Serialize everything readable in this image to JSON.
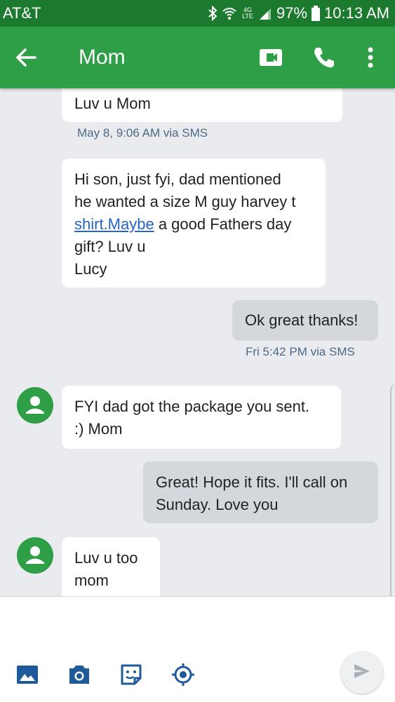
{
  "status_bar": {
    "carrier": "AT&T",
    "network": "4G LTE",
    "battery": "97%",
    "time": "10:13 AM",
    "icons": [
      "bluetooth-icon",
      "wifi-icon",
      "signal-icon",
      "battery-icon"
    ]
  },
  "app_bar": {
    "title": "Mom",
    "icons": [
      "back-arrow-icon",
      "video-call-icon",
      "phone-icon",
      "more-vert-icon"
    ]
  },
  "messages": [
    {
      "direction": "incoming",
      "text": "Luv u Mom",
      "meta": "May 8, 9:06 AM via SMS"
    },
    {
      "direction": "incoming",
      "lines": [
        "Hi son, just fyi, dad mentioned",
        "he wanted a size M guy harvey t"
      ],
      "link": "shirt.Maybe",
      "link_suffix": " a good Fathers day",
      "lines_after": [
        "gift? Luv u",
        "Lucy"
      ]
    },
    {
      "direction": "outgoing",
      "text": "Ok great thanks!",
      "meta": "Fri 5:42 PM via SMS"
    },
    {
      "direction": "incoming",
      "lines": [
        "FYI dad got the package you sent.",
        ":) Mom"
      ]
    },
    {
      "direction": "outgoing",
      "lines": [
        "Great! Hope it fits. I'll call on",
        "Sunday. Love you"
      ]
    },
    {
      "direction": "incoming",
      "lines": [
        "Luv u too",
        "mom"
      ]
    }
  ],
  "compose": {
    "placeholder": "",
    "tools": [
      "gallery-icon",
      "camera-icon",
      "sticker-icon",
      "location-icon"
    ],
    "send_icon": "send-icon"
  },
  "colors": {
    "status_bar": "#1b7a2e",
    "app_bar": "#2e9e47",
    "background": "#e9ebee",
    "incoming_bubble": "#ffffff",
    "outgoing_bubble": "#d4d8dd",
    "meta_text": "#4e6a88",
    "link": "#2563c9"
  }
}
